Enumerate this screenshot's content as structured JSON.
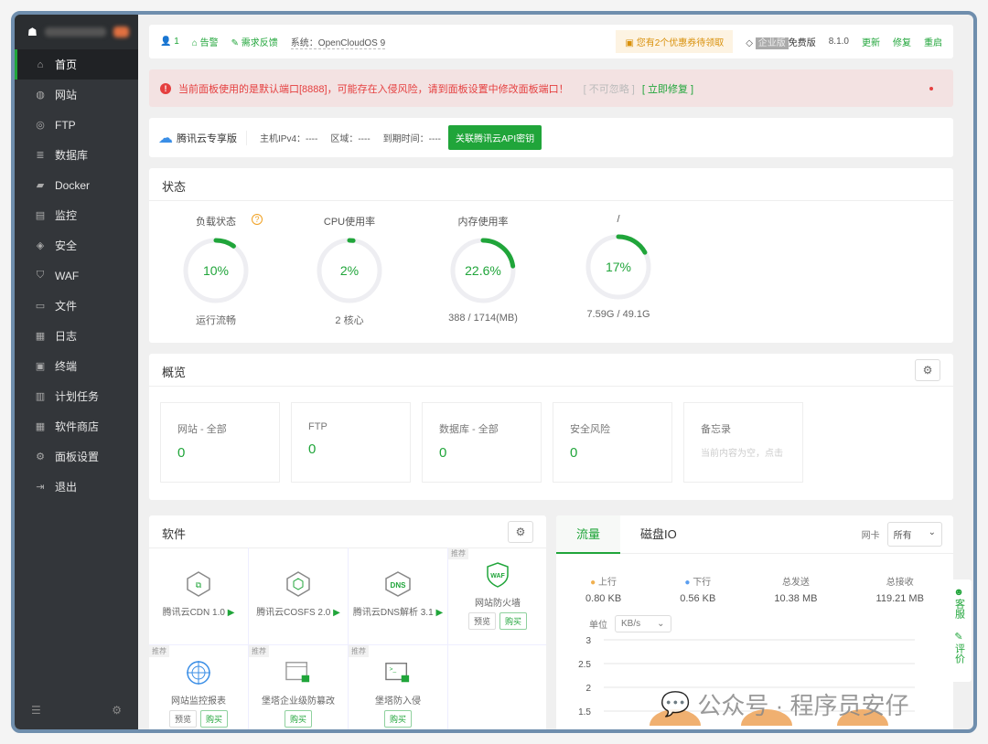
{
  "sidebar": {
    "items": [
      {
        "label": "首页",
        "icon": "home-icon"
      },
      {
        "label": "网站",
        "icon": "globe-icon"
      },
      {
        "label": "FTP",
        "icon": "ftp-icon"
      },
      {
        "label": "数据库",
        "icon": "database-icon"
      },
      {
        "label": "Docker",
        "icon": "docker-icon"
      },
      {
        "label": "监控",
        "icon": "monitor-icon"
      },
      {
        "label": "安全",
        "icon": "shield-icon"
      },
      {
        "label": "WAF",
        "icon": "waf-icon"
      },
      {
        "label": "文件",
        "icon": "folder-icon"
      },
      {
        "label": "日志",
        "icon": "log-icon"
      },
      {
        "label": "终端",
        "icon": "terminal-icon"
      },
      {
        "label": "计划任务",
        "icon": "calendar-icon"
      },
      {
        "label": "软件商店",
        "icon": "grid-icon"
      },
      {
        "label": "面板设置",
        "icon": "gear-icon"
      },
      {
        "label": "退出",
        "icon": "logout-icon"
      }
    ]
  },
  "topbar": {
    "user": "1",
    "alarm": "告警",
    "feedback": "需求反馈",
    "system": "系统：OpenCloudOS 9",
    "coupon": "您有2个优惠券待领取",
    "enterprise": "企业版",
    "free": "免费版",
    "version": "8.1.0",
    "update": "更新",
    "repair": "修复",
    "restart": "重启"
  },
  "alert": {
    "message": "当前面板使用的是默认端口[8888]，可能存在入侵风险，请到面板设置中修改面板端口！",
    "ignore": "[ 不可忽略 ]",
    "fix": "[ 立即修复 ]"
  },
  "tencent": {
    "title": "腾讯云专享版",
    "ipv4": "主机IPv4：----",
    "region": "区域：----",
    "expire": "到期时间：----",
    "button": "关联腾讯云API密钥"
  },
  "status": {
    "title": "状态",
    "gauges": [
      {
        "label": "负载状态",
        "value": "10%",
        "percent": 10,
        "sub": "运行流畅"
      },
      {
        "label": "CPU使用率",
        "value": "2%",
        "percent": 2,
        "sub": "2 核心"
      },
      {
        "label": "内存使用率",
        "value": "22.6%",
        "percent": 22.6,
        "sub": "388 / 1714(MB)"
      },
      {
        "label": "/",
        "value": "17%",
        "percent": 17,
        "sub": "7.59G / 49.1G"
      }
    ]
  },
  "overview": {
    "title": "概览",
    "items": [
      {
        "label": "网站 - 全部",
        "value": "0"
      },
      {
        "label": "FTP",
        "value": "0"
      },
      {
        "label": "数据库 - 全部",
        "value": "0"
      },
      {
        "label": "安全风险",
        "value": "0"
      },
      {
        "label": "备忘录",
        "value": "当前内容为空，点击"
      }
    ]
  },
  "software": {
    "title": "软件",
    "tag": "推荐",
    "preview": "预览",
    "buy": "购买",
    "items": [
      {
        "name": "腾讯云CDN 1.0"
      },
      {
        "name": "腾讯云COSFS 2.0"
      },
      {
        "name": "腾讯云DNS解析 3.1"
      },
      {
        "name": "网站防火墙"
      },
      {
        "name": "网站监控报表"
      },
      {
        "name": "堡塔企业级防篡改"
      },
      {
        "name": "堡塔防入侵"
      }
    ]
  },
  "flow": {
    "tabs": [
      "流量",
      "磁盘IO"
    ],
    "nic_label": "网卡",
    "nic_value": "所有",
    "unit_label": "单位",
    "unit_value": "KB/s",
    "stats": [
      {
        "label": "上行",
        "value": "0.80 KB"
      },
      {
        "label": "下行",
        "value": "0.56 KB"
      },
      {
        "label": "总发送",
        "value": "10.38 MB"
      },
      {
        "label": "总接收",
        "value": "119.21 MB"
      }
    ],
    "yticks": [
      "3",
      "2.5",
      "2",
      "1.5"
    ]
  },
  "float": {
    "service": "客服",
    "review": "评价"
  },
  "watermark": "公众号 · 程序员安仔",
  "colors": {
    "accent": "#20a53a",
    "sidebar": "#33363a",
    "alert": "#e53f3f"
  }
}
